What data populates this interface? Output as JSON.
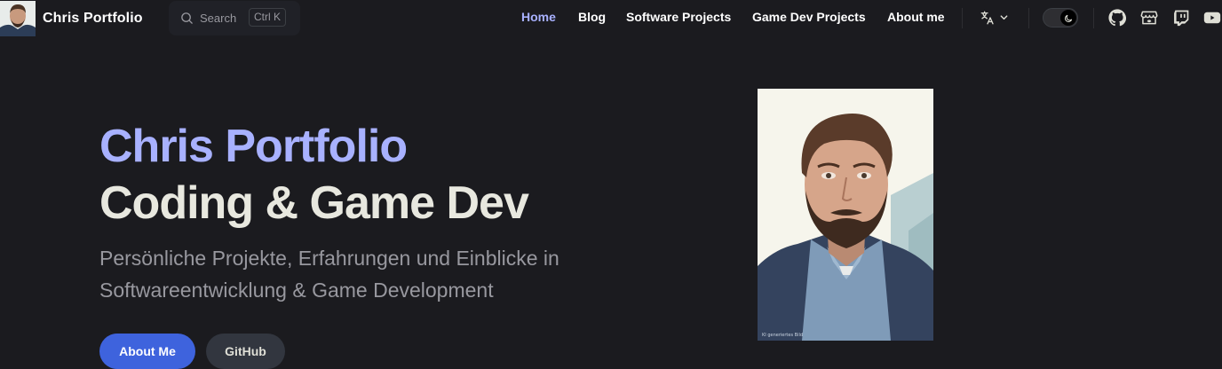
{
  "brand": {
    "title": "Chris Portfolio"
  },
  "search": {
    "label": "Search",
    "shortcut": "Ctrl K"
  },
  "nav": {
    "links": [
      {
        "label": "Home"
      },
      {
        "label": "Blog"
      },
      {
        "label": "Software Projects"
      },
      {
        "label": "Game Dev Projects"
      },
      {
        "label": "About me"
      }
    ]
  },
  "hero": {
    "name": "Chris Portfolio",
    "text": "Coding & Game Dev",
    "tagline": "Persönliche Projekte, Erfahrungen und Einblicke in Softwareentwicklung & Game Development",
    "actions": [
      {
        "label": "About Me"
      },
      {
        "label": "GitHub"
      }
    ],
    "image_caption": "KI generiertes Bild"
  },
  "icons": {
    "language": "translate-icon",
    "theme": "moon-icon",
    "social": [
      "github-icon",
      "itchio-icon",
      "twitch-icon",
      "youtube-icon"
    ]
  },
  "colors": {
    "background": "#1b1b1f",
    "brand": "#3e63dd",
    "active_link": "#a8b1ff",
    "hero_name": "#a8b1ff"
  }
}
